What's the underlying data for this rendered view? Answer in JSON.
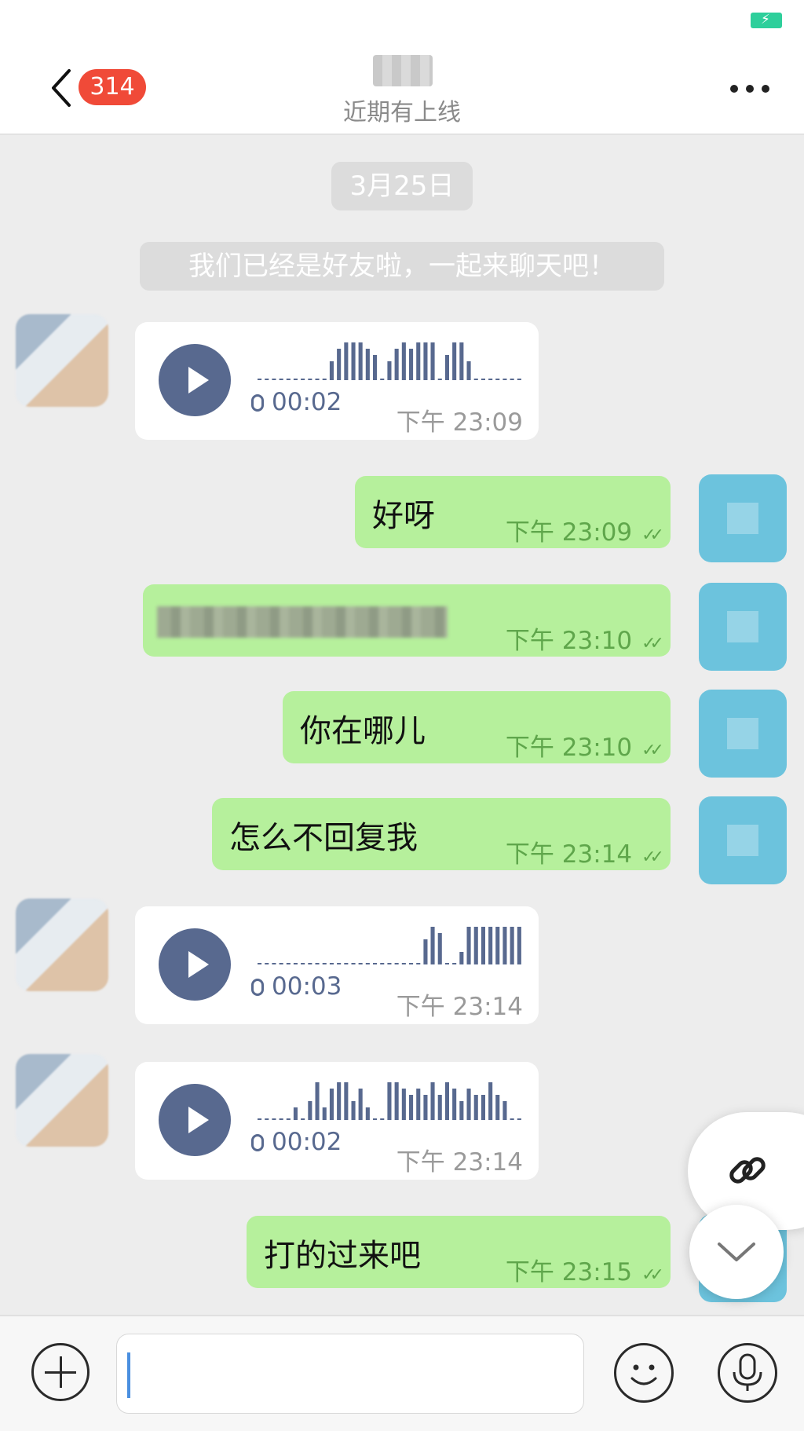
{
  "colors": {
    "badge": "#f04a38",
    "battery": "#2ecf9b",
    "status_text": "#8a8a8a",
    "outgoing_bubble": "#b6f09c",
    "voice_accent": "#58698f"
  },
  "header": {
    "unread_count": "314",
    "contact_name": "██",
    "contact_status": "近期有上线",
    "back_icon": "chevron-left-icon",
    "more_icon": "more-dots-icon"
  },
  "chat": {
    "date_label": "3月25日",
    "system_message": "我们已经是好友啦，一起来聊天吧！",
    "messages": [
      {
        "type": "voice",
        "direction": "in",
        "duration": "00:02",
        "time": "下午  23:09"
      },
      {
        "type": "text",
        "direction": "out",
        "text": "好呀",
        "time": "下午  23:09"
      },
      {
        "type": "text",
        "direction": "out",
        "text": "",
        "time": "下午  23:10"
      },
      {
        "type": "text",
        "direction": "out",
        "text": "你在哪儿",
        "time": "下午  23:10"
      },
      {
        "type": "text",
        "direction": "out",
        "text": "怎么不回复我",
        "time": "下午  23:14"
      },
      {
        "type": "voice",
        "direction": "in",
        "duration": "00:03",
        "time": "下午  23:14"
      },
      {
        "type": "voice",
        "direction": "in",
        "duration": "00:02",
        "time": "下午  23:14"
      },
      {
        "type": "text",
        "direction": "out",
        "text": "打的过来吧",
        "time": "下午  23:15"
      }
    ]
  },
  "input": {
    "placeholder": "",
    "plus_icon": "plus-icon",
    "emoji_icon": "emoji-icon",
    "voice_icon": "microphone-icon",
    "link_icon": "link-icon",
    "scroll_down_icon": "chevron-down-icon"
  }
}
